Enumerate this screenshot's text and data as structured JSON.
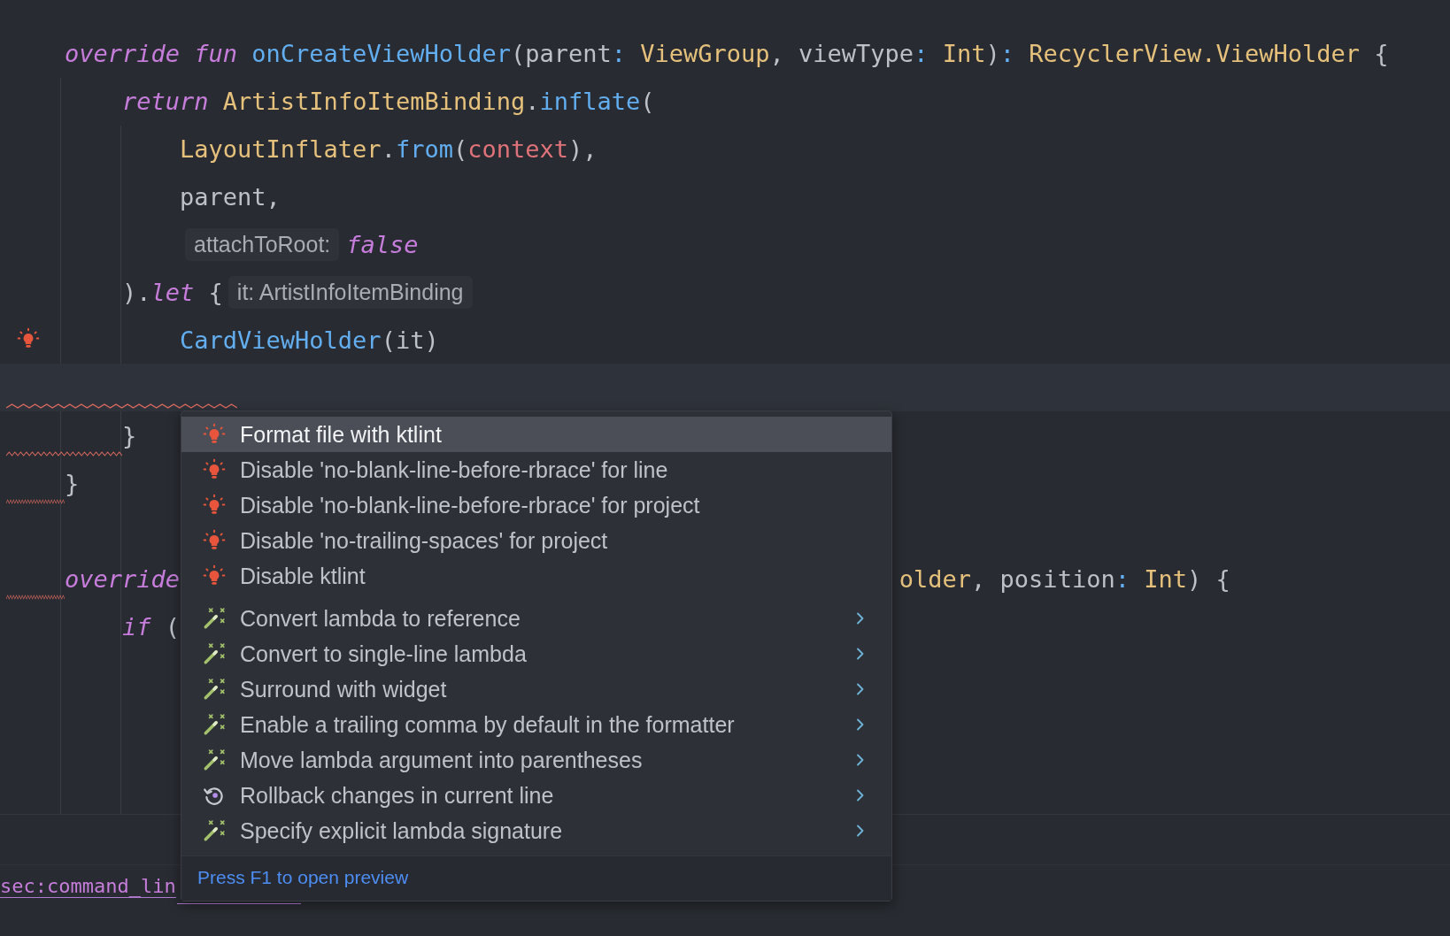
{
  "editor": {
    "code_lines": [
      {
        "tokens": [
          {
            "text": "override",
            "kind": "keyword"
          },
          {
            "text": " fun",
            "kind": "keyword"
          },
          {
            "text": " onCreateViewHolder",
            "kind": "function"
          },
          {
            "text": "(parent",
            "kind": "plain"
          },
          {
            "text": ":",
            "kind": "colon"
          },
          {
            "text": " ViewGroup",
            "kind": "type"
          },
          {
            "text": ", viewType",
            "kind": "plain"
          },
          {
            "text": ":",
            "kind": "colon"
          },
          {
            "text": " Int",
            "kind": "type"
          },
          {
            "text": ")",
            "kind": "plain"
          },
          {
            "text": ":",
            "kind": "colon"
          },
          {
            "text": " RecyclerView.ViewHolder",
            "kind": "type"
          },
          {
            "text": " {",
            "kind": "plain"
          }
        ],
        "children": [
          {
            "tokens": [
              {
                "text": "return",
                "kind": "keyword"
              },
              {
                "text": " ArtistInfoItemBinding",
                "kind": "type"
              },
              {
                "text": ".",
                "kind": "plain"
              },
              {
                "text": "inflate",
                "kind": "function"
              },
              {
                "text": "(",
                "kind": "plain"
              }
            ],
            "children": [
              {
                "tokens": [
                  {
                    "text": "LayoutInflater",
                    "kind": "type"
                  },
                  {
                    "text": ".",
                    "kind": "plain"
                  },
                  {
                    "text": "from",
                    "kind": "function"
                  },
                  {
                    "text": "(",
                    "kind": "plain"
                  },
                  {
                    "text": "context",
                    "kind": "property"
                  },
                  {
                    "text": "),",
                    "kind": "plain"
                  }
                ]
              },
              {
                "tokens": [
                  {
                    "text": "parent,",
                    "kind": "plain"
                  }
                ]
              },
              {
                "tokens": [
                  {
                    "text": "attachToRoot:",
                    "kind": "hint"
                  },
                  {
                    "text": "false",
                    "kind": "keyword"
                  }
                ]
              }
            ]
          },
          {
            "tokens": [
              {
                "text": ").",
                "kind": "plain"
              },
              {
                "text": "let",
                "kind": "keyword"
              },
              {
                "text": " {",
                "kind": "plain"
              },
              {
                "text": "it: ArtistInfoItemBinding",
                "kind": "hint"
              }
            ],
            "children": [
              {
                "bulb": true,
                "tokens": [
                  {
                    "text": "CardViewHolder",
                    "kind": "function"
                  },
                  {
                    "text": "(it)",
                    "kind": "plain"
                  }
                ]
              },
              {
                "current": true,
                "warning": true
              }
            ]
          },
          {
            "warning": true,
            "tokens": [
              {
                "text": "}",
                "kind": "plain"
              }
            ]
          }
        ]
      },
      {
        "warning": true,
        "tokens": [
          {
            "text": "}",
            "kind": "plain"
          }
        ]
      },
      {
        "warning": true,
        "gap_before": true,
        "tokens": [
          {
            "text": "override",
            "kind": "keyword"
          }
        ],
        "tail": [
          {
            "text": "older",
            "kind": "type"
          },
          {
            "text": ", position",
            "kind": "plain"
          },
          {
            "text": ":",
            "kind": "colon"
          },
          {
            "text": " Int",
            "kind": "type"
          },
          {
            "text": ") {",
            "kind": "plain"
          }
        ],
        "children": [
          {
            "tokens": [
              {
                "text": "if",
                "kind": "keyword"
              },
              {
                "text": " (",
                "kind": "plain"
              }
            ]
          }
        ]
      }
    ]
  },
  "intention_popup": {
    "items": [
      {
        "label": "Format file with ktlint",
        "kind": "bulb",
        "has_submenu": false,
        "selected": true
      },
      {
        "label": "Disable 'no-blank-line-before-rbrace' for line",
        "kind": "bulb",
        "has_submenu": false,
        "selected": false
      },
      {
        "label": "Disable 'no-blank-line-before-rbrace' for project",
        "kind": "bulb",
        "has_submenu": false,
        "selected": false
      },
      {
        "label": "Disable 'no-trailing-spaces' for project",
        "kind": "bulb",
        "has_submenu": false,
        "selected": false
      },
      {
        "label": "Disable ktlint",
        "kind": "bulb",
        "has_submenu": false,
        "selected": false
      },
      {
        "label": "Convert lambda to reference",
        "kind": "wand",
        "has_submenu": true,
        "selected": false
      },
      {
        "label": "Convert to single-line lambda",
        "kind": "wand",
        "has_submenu": true,
        "selected": false
      },
      {
        "label": "Surround with widget",
        "kind": "wand",
        "has_submenu": true,
        "selected": false
      },
      {
        "label": "Enable a trailing comma by default in the formatter",
        "kind": "wand",
        "has_submenu": true,
        "selected": false
      },
      {
        "label": "Move lambda argument into parentheses",
        "kind": "wand",
        "has_submenu": true,
        "selected": false
      },
      {
        "label": "Rollback changes in current line",
        "kind": "rollback",
        "has_submenu": true,
        "selected": false
      },
      {
        "label": "Specify explicit lambda signature",
        "kind": "wand",
        "has_submenu": true,
        "selected": false
      }
    ],
    "footer": "Press F1 to open preview"
  },
  "bottom_panel": {
    "link_text": "sec:command_lin"
  }
}
